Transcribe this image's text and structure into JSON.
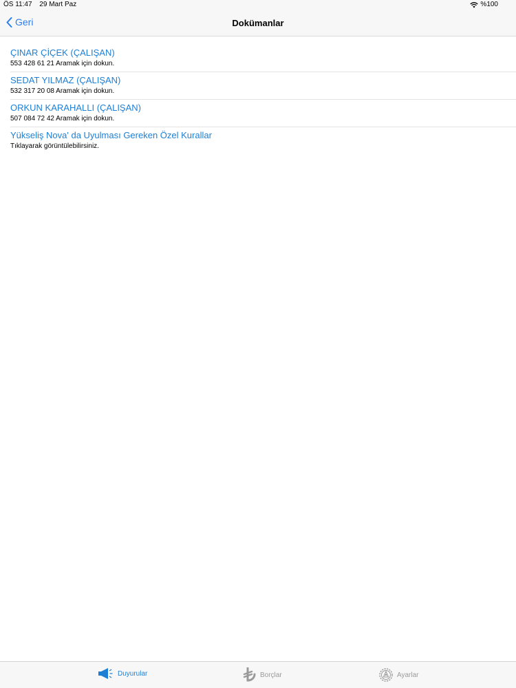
{
  "status_bar": {
    "time": "ÖS 11:47",
    "date": "29 Mart Paz",
    "battery": "%100",
    "icons": [
      "wifi-icon",
      "battery-icon"
    ]
  },
  "nav": {
    "back_label": "Geri",
    "title": "Dokümanlar"
  },
  "items": [
    {
      "title": "ÇINAR ÇİÇEK (ÇALIŞAN)",
      "subtitle": "553 428 61 21 Aramak için dokun."
    },
    {
      "title": "SEDAT YILMAZ (ÇALIŞAN)",
      "subtitle": "532 317 20 08 Aramak için dokun."
    },
    {
      "title": "ORKUN KARAHALLI (ÇALIŞAN)",
      "subtitle": "507 084 72 42 Aramak için dokun."
    },
    {
      "title": "Yükseliş Nova' da Uyulması Gereken Özel Kurallar",
      "subtitle": "Tıklayarak görüntülebilirsiniz."
    }
  ],
  "tabs": [
    {
      "label": "Duyurular",
      "icon": "megaphone-icon",
      "active": true
    },
    {
      "label": "Borçlar",
      "icon": "lira-icon",
      "active": false
    },
    {
      "label": "Ayarlar",
      "icon": "settings-gear-icon",
      "active": false
    }
  ],
  "colors": {
    "accent": "#1d7fd4",
    "bar_background": "#f7f7f7",
    "inactive_tab": "#9a9a9a"
  }
}
